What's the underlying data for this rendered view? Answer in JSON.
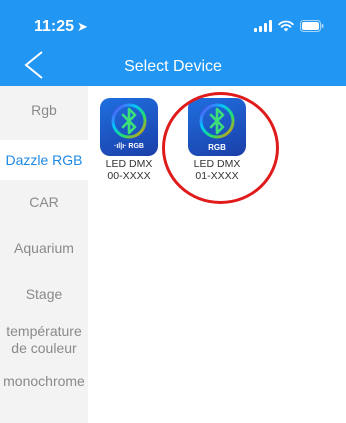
{
  "status_bar": {
    "time": "11:25",
    "location_glyph": "➤"
  },
  "header": {
    "title": "Select Device",
    "back_icon": "chevron-left-icon"
  },
  "sidebar": {
    "items": [
      {
        "label": "Rgb",
        "active": false
      },
      {
        "label": "Dazzle RGB",
        "active": true
      },
      {
        "label": "CAR",
        "active": false
      },
      {
        "label": "Aquarium",
        "active": false
      },
      {
        "label": "Stage",
        "active": false
      },
      {
        "label": "température de couleur",
        "active": false
      },
      {
        "label": "monochrome",
        "active": false
      }
    ]
  },
  "devices": [
    {
      "badge": "·ıl|ı· RGB",
      "name": "LED DMX",
      "id": "00-XXXX",
      "icon": "bluetooth-icon"
    },
    {
      "badge": "RGB",
      "name": "LED DMX",
      "id": "01-XXXX",
      "icon": "bluetooth-icon"
    }
  ],
  "colors": {
    "header_bg": "#2196f3",
    "active_text": "#1e88e5",
    "highlight": "#e01b1b"
  }
}
